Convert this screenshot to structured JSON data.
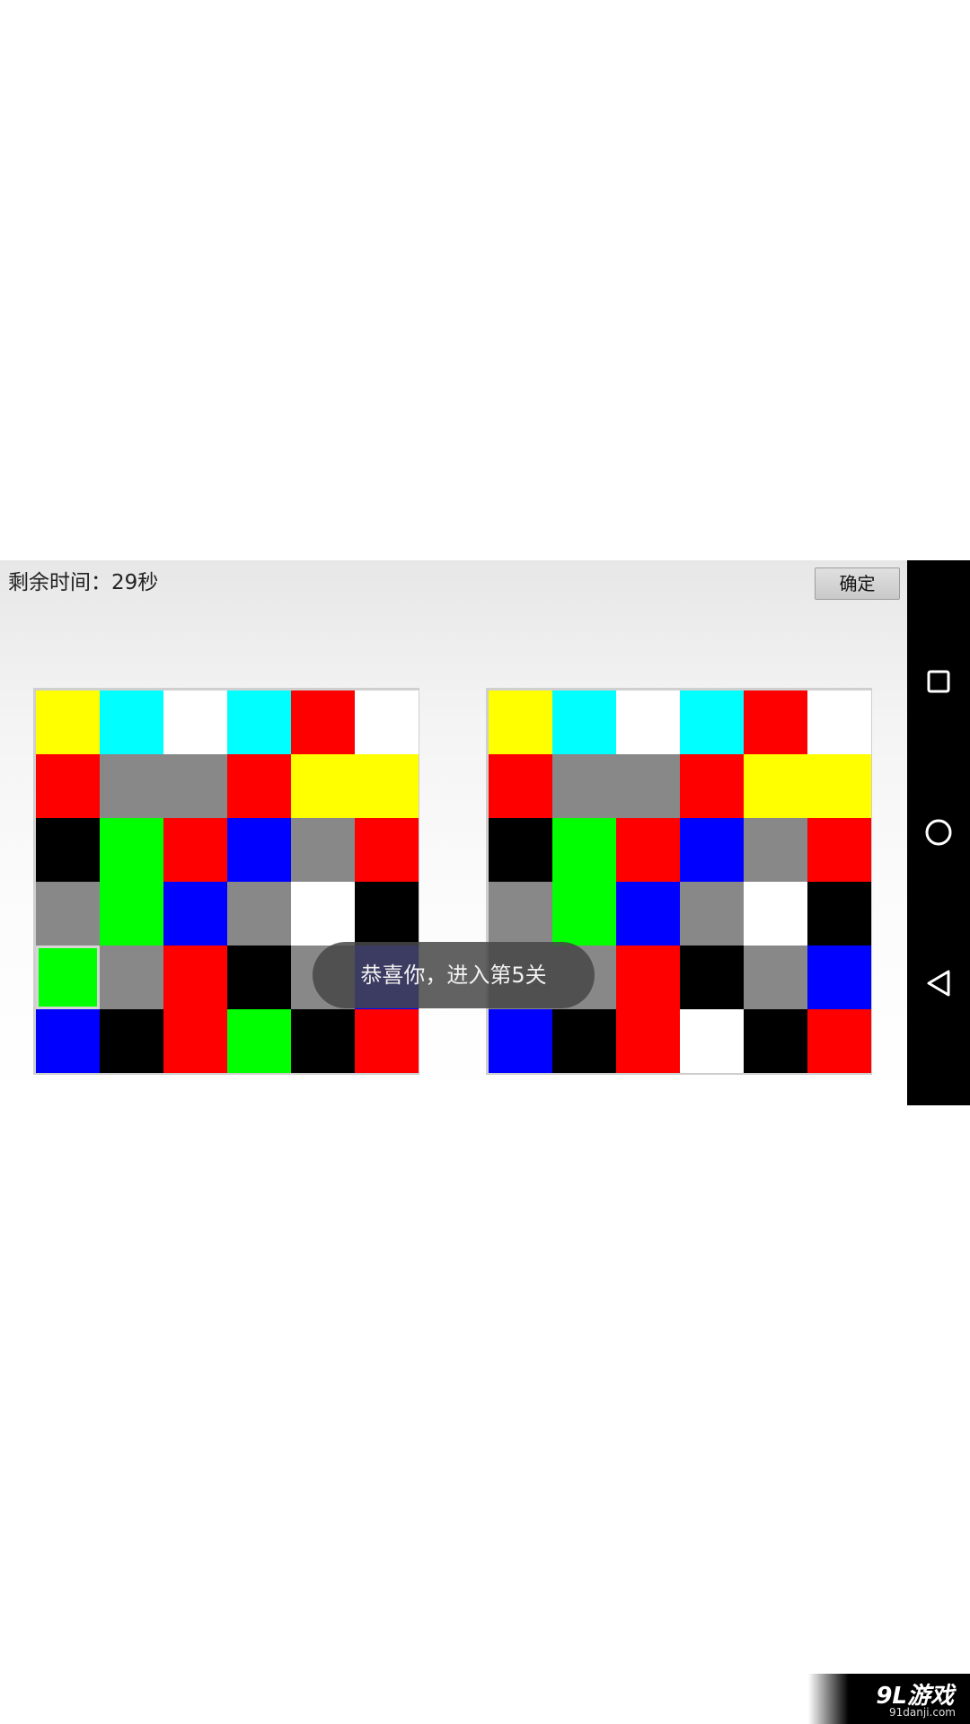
{
  "header": {
    "timer_text": "剩余时间：29秒",
    "confirm_label": "确定"
  },
  "toast": {
    "message": "恭喜你，进入第5关"
  },
  "colors": {
    "Y": "#ffff00",
    "C": "#00ffff",
    "W": "#ffffff",
    "R": "#ff0000",
    "G": "#888888",
    "K": "#000000",
    "L": "#00ff00",
    "B": "#0000ff"
  },
  "boards": [
    {
      "name": "left-board",
      "rows": [
        [
          "Y",
          "C",
          "W",
          "C",
          "R",
          "W"
        ],
        [
          "R",
          "G",
          "G",
          "R",
          "Y",
          "Y"
        ],
        [
          "K",
          "L",
          "R",
          "B",
          "G",
          "R"
        ],
        [
          "G",
          "L",
          "B",
          "G",
          "W",
          "K"
        ],
        [
          "L",
          "G",
          "R",
          "K",
          "G",
          "B"
        ],
        [
          "B",
          "K",
          "R",
          "L",
          "K",
          "R"
        ]
      ],
      "selected": [
        4,
        0
      ]
    },
    {
      "name": "right-board",
      "rows": [
        [
          "Y",
          "C",
          "W",
          "C",
          "R",
          "W"
        ],
        [
          "R",
          "G",
          "G",
          "R",
          "Y",
          "Y"
        ],
        [
          "K",
          "L",
          "R",
          "B",
          "G",
          "R"
        ],
        [
          "G",
          "L",
          "B",
          "G",
          "W",
          "K"
        ],
        [
          "G",
          "G",
          "R",
          "K",
          "G",
          "B"
        ],
        [
          "B",
          "K",
          "R",
          "W",
          "K",
          "R"
        ]
      ],
      "selected": null
    }
  ],
  "nav": {
    "recents_icon": "square-icon",
    "home_icon": "circle-icon",
    "back_icon": "triangle-back-icon"
  },
  "watermark": {
    "logo": "9L游戏",
    "url": "91danji.com"
  }
}
